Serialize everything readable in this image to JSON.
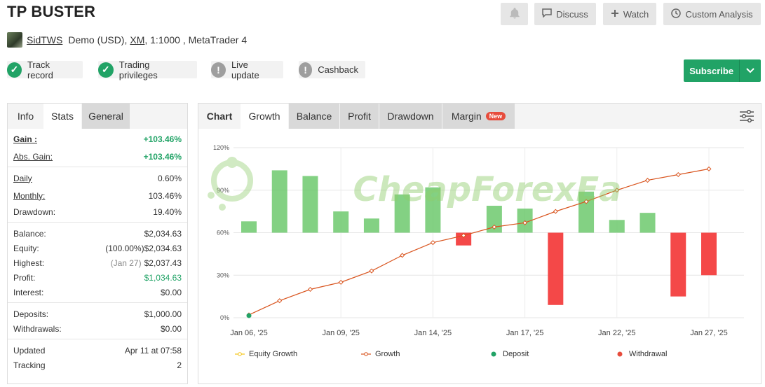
{
  "title": "TP BUSTER",
  "header_buttons": {
    "discuss": "Discuss",
    "watch": "Watch",
    "custom_analysis": "Custom Analysis"
  },
  "account": {
    "user": "SidTWS",
    "type": "Demo (USD),",
    "broker": "XM",
    "rest": ", 1:1000 , MetaTrader 4"
  },
  "badges": [
    {
      "label": "Track record",
      "status": "ok",
      "icon": "check-icon"
    },
    {
      "label": "Trading privileges",
      "status": "ok",
      "icon": "check-icon"
    },
    {
      "label": "Live update",
      "status": "warn",
      "icon": "exclamation-icon"
    },
    {
      "label": "Cashback",
      "status": "warn",
      "icon": "exclamation-icon"
    }
  ],
  "subscribe": {
    "label": "Subscribe"
  },
  "left_tabs": [
    "Info",
    "Stats",
    "General"
  ],
  "stats": {
    "gain": {
      "label": "Gain :",
      "value": "+103.46%"
    },
    "abs_gain": {
      "label": "Abs. Gain:",
      "value": "+103.46%"
    },
    "daily": {
      "label": "Daily",
      "value": "0.60%"
    },
    "monthly": {
      "label": "Monthly:",
      "value": "103.46%"
    },
    "drawdown": {
      "label": "Drawdown:",
      "value": "19.40%"
    },
    "balance": {
      "label": "Balance:",
      "value": "$2,034.63"
    },
    "equity": {
      "label": "Equity:",
      "pct": "(100.00%)",
      "value": "$2,034.63"
    },
    "highest": {
      "label": "Highest:",
      "date": "(Jan 27)",
      "value": "$2,037.43"
    },
    "profit": {
      "label": "Profit:",
      "value": "$1,034.63"
    },
    "interest": {
      "label": "Interest:",
      "value": "$0.00"
    },
    "deposits": {
      "label": "Deposits:",
      "value": "$1,000.00"
    },
    "withdrawals": {
      "label": "Withdrawals:",
      "value": "$0.00"
    },
    "updated": {
      "label": "Updated",
      "value": "Apr 11 at 07:58"
    },
    "tracking": {
      "label": "Tracking",
      "value": "2"
    }
  },
  "chart_tabs": {
    "chart": "Chart",
    "growth": "Growth",
    "balance": "Balance",
    "profit": "Profit",
    "drawdown": "Drawdown",
    "margin": "Margin",
    "new_badge": "New"
  },
  "watermark": "CheapForexEa",
  "colors": {
    "accent_green": "#21a366",
    "bar_positive": "#6dc96d",
    "bar_negative": "#f44848",
    "growth_line": "#d9541e"
  },
  "chart_data": {
    "type": "bar",
    "y_ticks": [
      "120%",
      "90%",
      "60%",
      "30%",
      "0%"
    ],
    "ylim": [
      0,
      120
    ],
    "x_tick_labels": [
      "Jan 06, '25",
      "Jan 09, '25",
      "Jan 14, '25",
      "Jan 17, '25",
      "Jan 22, '25",
      "Jan 27, '25"
    ],
    "points": 16,
    "growth": [
      2,
      12,
      20,
      25,
      33,
      44,
      53,
      58,
      64,
      67,
      75,
      82,
      90,
      97,
      101,
      105
    ],
    "bar_baseline": 60,
    "bar_tops": [
      68,
      104,
      100,
      75,
      70,
      87,
      92,
      51,
      79,
      77,
      9,
      89,
      69,
      74,
      15,
      30
    ],
    "legend": [
      "Equity Growth",
      "Growth",
      "Deposit",
      "Withdrawal"
    ]
  }
}
